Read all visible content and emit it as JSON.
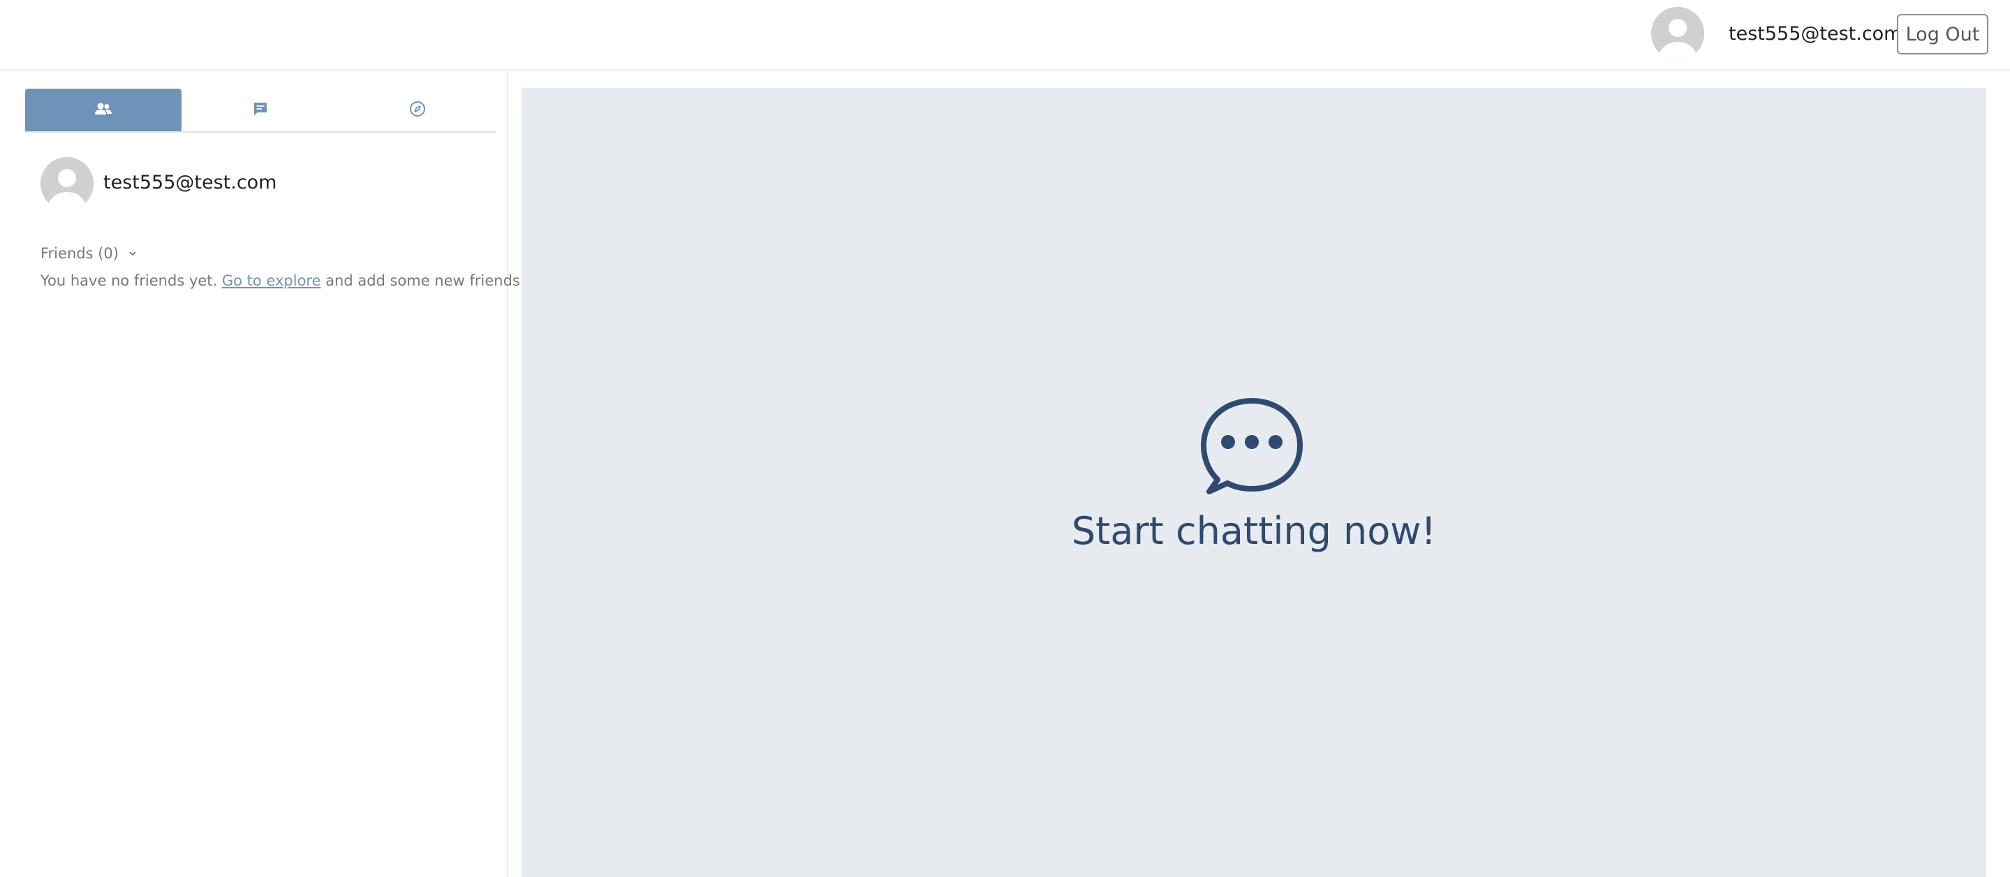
{
  "header": {
    "user_email": "test555@test.com",
    "logout_label": "Log Out",
    "avatar_icon": "user-avatar-icon"
  },
  "sidebar": {
    "tabs": [
      {
        "id": "friends",
        "icon": "users-icon",
        "active": true
      },
      {
        "id": "chats",
        "icon": "message-square-icon",
        "active": false
      },
      {
        "id": "explore",
        "icon": "compass-icon",
        "active": false
      }
    ],
    "profile": {
      "email": "test555@test.com"
    },
    "friends": {
      "label": "Friends (0)",
      "empty_prefix": "You have no friends yet. ",
      "explore_link": "Go to explore",
      "empty_suffix": " and add some new friends!"
    }
  },
  "main": {
    "empty_state_text": "Start chatting now!",
    "empty_state_icon": "chat-bubble-icon"
  },
  "colors": {
    "accent": "#6f93b8",
    "panel_bg": "#e7ebef",
    "dark_blue": "#2f4a70",
    "muted_text": "#777777"
  }
}
